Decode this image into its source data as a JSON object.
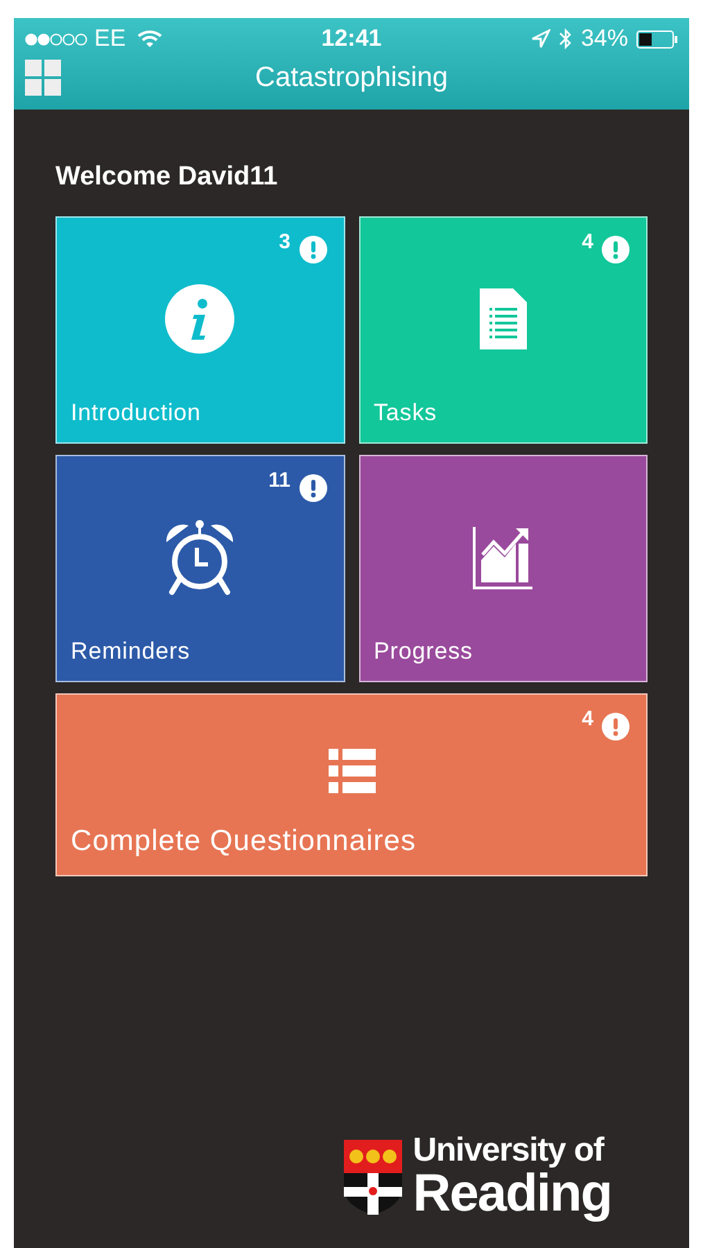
{
  "status_bar": {
    "carrier": "EE",
    "time": "12:41",
    "battery": "34%"
  },
  "nav_bar": {
    "title": "Catastrophising"
  },
  "welcome": "Welcome David11",
  "tiles": [
    {
      "label": "Introduction",
      "count": "3",
      "kind": "info",
      "color": "#0fbccc",
      "wide": false
    },
    {
      "label": "Tasks",
      "count": "4",
      "kind": "document",
      "color": "#12c79a",
      "wide": false
    },
    {
      "label": "Reminders",
      "count": "11",
      "kind": "alarm",
      "color": "#2c5aa8",
      "wide": false
    },
    {
      "label": "Progress",
      "kind": "chart",
      "color": "#9a4a9c",
      "wide": false
    },
    {
      "label": "Complete Questionnaires",
      "count": "4",
      "kind": "list",
      "color": "#e77553",
      "wide": true
    }
  ],
  "footer": {
    "logo_line_1": "University of",
    "logo_line_2": "Reading"
  }
}
